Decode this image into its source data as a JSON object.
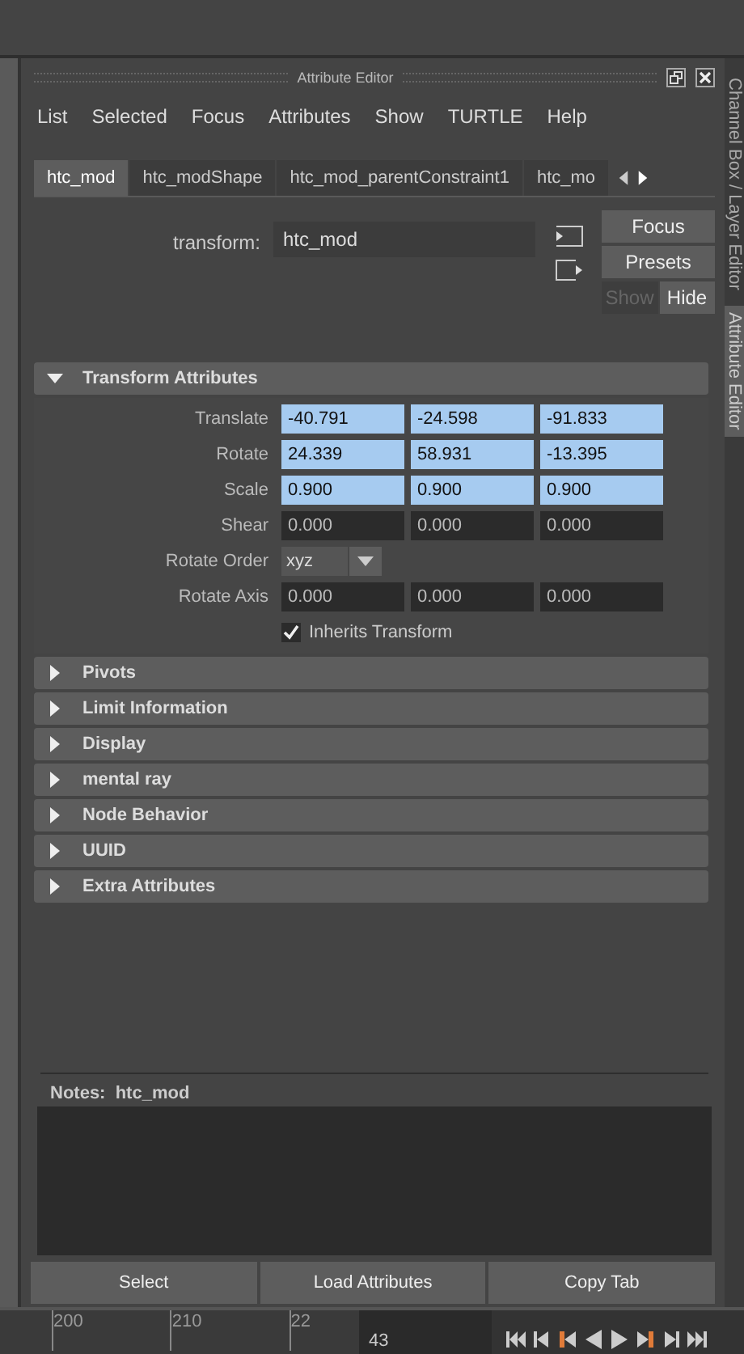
{
  "panel": {
    "title": "Attribute Editor"
  },
  "side_tabs": [
    {
      "label": "Channel Box / Layer Editor",
      "selected": false
    },
    {
      "label": "Attribute Editor",
      "selected": true
    }
  ],
  "menu": [
    "List",
    "Selected",
    "Focus",
    "Attributes",
    "Show",
    "TURTLE",
    "Help"
  ],
  "tabs": [
    {
      "label": "htc_mod",
      "selected": true
    },
    {
      "label": "htc_modShape",
      "selected": false
    },
    {
      "label": "htc_mod_parentConstraint1",
      "selected": false
    },
    {
      "label": "htc_mo",
      "selected": false
    }
  ],
  "transform": {
    "label": "transform:",
    "value": "htc_mod"
  },
  "side_buttons": [
    {
      "label": "Focus",
      "disabled": false
    },
    {
      "label": "Presets",
      "disabled": false
    }
  ],
  "visibility_buttons": [
    {
      "label": "Show",
      "selected": false
    },
    {
      "label": "Hide",
      "selected": true
    }
  ],
  "sections": [
    {
      "title": "Transform Attributes",
      "expanded": true,
      "attributes": [
        {
          "kind": "vector",
          "label": "Translate",
          "keyed": true,
          "values": [
            "-40.791",
            "-24.598",
            "-91.833"
          ]
        },
        {
          "kind": "vector",
          "label": "Rotate",
          "keyed": true,
          "values": [
            "24.339",
            "58.931",
            "-13.395"
          ]
        },
        {
          "kind": "vector",
          "label": "Scale",
          "keyed": true,
          "values": [
            "0.900",
            "0.900",
            "0.900"
          ]
        },
        {
          "kind": "vector",
          "label": "Shear",
          "keyed": false,
          "values": [
            "0.000",
            "0.000",
            "0.000"
          ]
        },
        {
          "kind": "dropdown",
          "label": "Rotate Order",
          "value": "xyz"
        },
        {
          "kind": "vector",
          "label": "Rotate Axis",
          "keyed": false,
          "values": [
            "0.000",
            "0.000",
            "0.000"
          ]
        },
        {
          "kind": "checkbox",
          "label": "Inherits Transform",
          "checked": true
        }
      ]
    },
    {
      "title": "Pivots",
      "expanded": false
    },
    {
      "title": "Limit Information",
      "expanded": false
    },
    {
      "title": "Display",
      "expanded": false
    },
    {
      "title": "mental ray",
      "expanded": false
    },
    {
      "title": "Node Behavior",
      "expanded": false
    },
    {
      "title": "UUID",
      "expanded": false
    },
    {
      "title": "Extra Attributes",
      "expanded": false
    }
  ],
  "notes": {
    "label": "Notes:",
    "value": "htc_mod"
  },
  "bottom_buttons": [
    "Select",
    "Load Attributes",
    "Copy Tab"
  ],
  "timeline": {
    "ticks": [
      "200",
      "210",
      "22"
    ],
    "current_frame": "43"
  }
}
